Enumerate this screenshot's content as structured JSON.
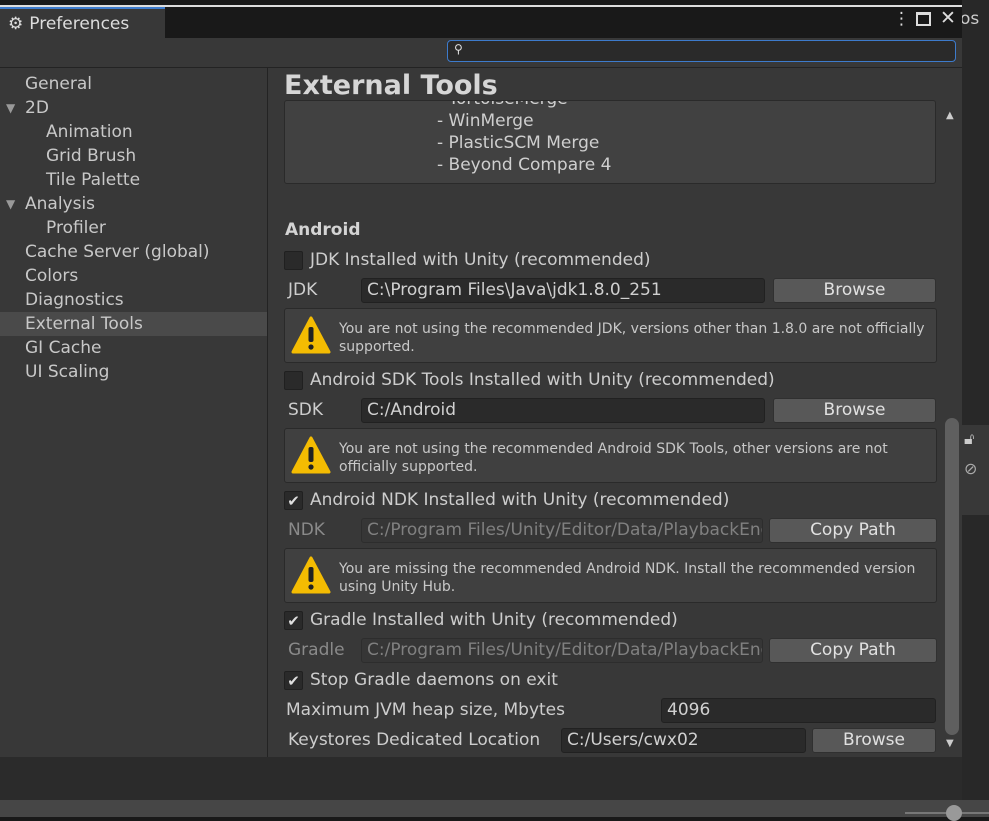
{
  "window": {
    "tab_title": "Preferences",
    "tab_icon": "gear-icon",
    "menu_icon": "kebab-icon",
    "maximize_icon": "maximize-icon",
    "close_icon": "close-icon",
    "right_panel_fragment": "os"
  },
  "search": {
    "placeholder": "",
    "value": ""
  },
  "sidebar": {
    "items": [
      {
        "label": "General",
        "level": 0
      },
      {
        "label": "2D",
        "level": 0,
        "expanded": true
      },
      {
        "label": "Animation",
        "level": 1
      },
      {
        "label": "Grid Brush",
        "level": 1
      },
      {
        "label": "Tile Palette",
        "level": 1
      },
      {
        "label": "Analysis",
        "level": 0,
        "expanded": true
      },
      {
        "label": "Profiler",
        "level": 1
      },
      {
        "label": "Cache Server (global)",
        "level": 0
      },
      {
        "label": "Colors",
        "level": 0
      },
      {
        "label": "Diagnostics",
        "level": 0
      },
      {
        "label": "External Tools",
        "level": 0,
        "selected": true
      },
      {
        "label": "GI Cache",
        "level": 0
      },
      {
        "label": "UI Scaling",
        "level": 0
      }
    ]
  },
  "main": {
    "title": "External Tools",
    "diff_tools": [
      "- TortoiseMerge",
      "- WinMerge",
      "- PlasticSCM Merge",
      "- Beyond Compare 4"
    ],
    "android": {
      "header": "Android",
      "jdk_checkbox": {
        "label": "JDK Installed with Unity (recommended)",
        "checked": false
      },
      "jdk": {
        "label": "JDK",
        "value": "C:\\Program Files\\Java\\jdk1.8.0_251",
        "button": "Browse"
      },
      "jdk_warning": "You are not using the recommended JDK, versions other than 1.8.0 are not officially supported.",
      "sdk_checkbox": {
        "label": "Android SDK Tools Installed with Unity (recommended)",
        "checked": false
      },
      "sdk": {
        "label": "SDK",
        "value": "C:/Android",
        "button": "Browse"
      },
      "sdk_warning": "You are not using the recommended Android SDK Tools, other versions are not officially supported.",
      "ndk_checkbox": {
        "label": "Android NDK Installed with Unity (recommended)",
        "checked": true
      },
      "ndk": {
        "label": "NDK",
        "value": "C:/Program Files/Unity/Editor/Data/PlaybackEngines/AndroidPlayer/NDK",
        "button": "Copy Path"
      },
      "ndk_warning": "You are missing the recommended Android NDK. Install the recommended version using Unity Hub.",
      "gradle_checkbox": {
        "label": "Gradle Installed with Unity (recommended)",
        "checked": true
      },
      "gradle": {
        "label": "Gradle",
        "value": "C:/Program Files/Unity/Editor/Data/PlaybackEngines/AndroidPlayer/Tools/gradle",
        "button": "Copy Path"
      },
      "stop_gradle": {
        "label": "Stop Gradle daemons on exit",
        "checked": true
      },
      "jvm_heap": {
        "label": "Maximum JVM heap size, Mbytes",
        "value": "4096"
      },
      "keystores": {
        "label": "Keystores Dedicated Location",
        "value": "C:/Users/cwx02",
        "button": "Browse"
      }
    }
  },
  "colors": {
    "accent": "#3d7bcc",
    "warning": "#f4bc02",
    "background": "#383838"
  }
}
